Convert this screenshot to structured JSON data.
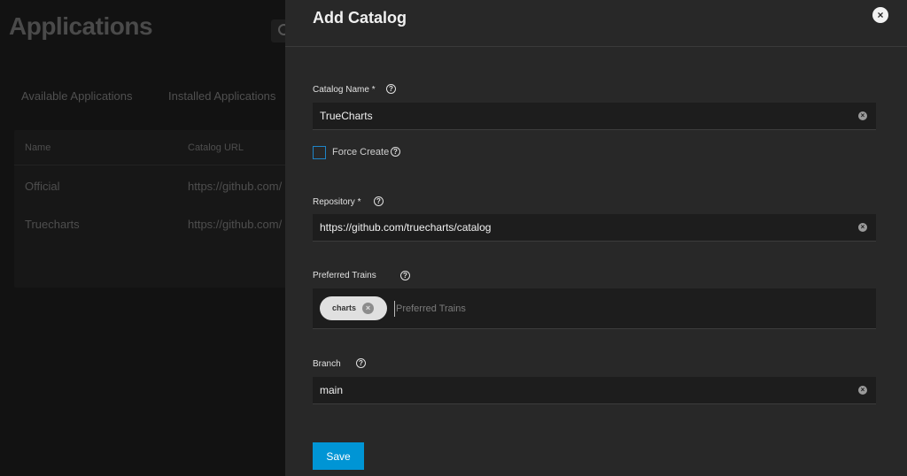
{
  "background": {
    "title": "Applications",
    "tabs": [
      "Available Applications",
      "Installed Applications"
    ],
    "table": {
      "headers": [
        "Name",
        "Catalog URL"
      ],
      "rows": [
        {
          "name": "Official",
          "url": "https://github.com/"
        },
        {
          "name": "Truecharts",
          "url": "https://github.com/"
        }
      ]
    }
  },
  "dialog": {
    "title": "Add Catalog",
    "close_icon": "close-circle-icon",
    "catalog_name": {
      "label": "Catalog Name *",
      "value": "TrueCharts"
    },
    "force_create": {
      "label": "Force Create",
      "checked": false
    },
    "repository": {
      "label": "Repository *",
      "value": "https://github.com/truecharts/catalog"
    },
    "preferred_trains": {
      "label": "Preferred Trains",
      "chips": [
        "charts"
      ],
      "placeholder": "Preferred Trains"
    },
    "branch": {
      "label": "Branch",
      "value": "main"
    },
    "save_label": "Save",
    "help_glyph": "?",
    "clear_glyph": "×"
  },
  "colors": {
    "accent": "#0095d5",
    "panel": "#282828",
    "checkbox_border": "#1f84c6"
  }
}
